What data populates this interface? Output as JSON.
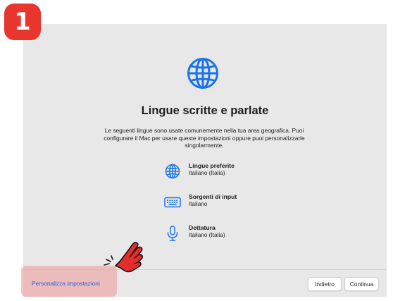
{
  "step_badge": "1",
  "title": "Lingue scritte e parlate",
  "description": "Le seguenti lingue sono usate comunemente nella tua area geografica. Puoi configurare il Mac per usare queste impostazioni oppure puoi personalizzarle singolarmente.",
  "items": [
    {
      "icon": "globe-icon",
      "label": "Lingue preferite",
      "value": "Italiano (Italia)"
    },
    {
      "icon": "keyboard-icon",
      "label": "Sorgenti di input",
      "value": "Italiano"
    },
    {
      "icon": "microphone-icon",
      "label": "Dettatura",
      "value": "Italiano (Italia)"
    }
  ],
  "footer": {
    "customize_link": "Personalizza impostazioni",
    "back_button": "Indietro",
    "continue_button": "Continua"
  },
  "colors": {
    "accent": "#1a73e8",
    "badge": "#e8362f",
    "highlight": "#ee9696",
    "pointer_hand": "#e32d2d"
  }
}
